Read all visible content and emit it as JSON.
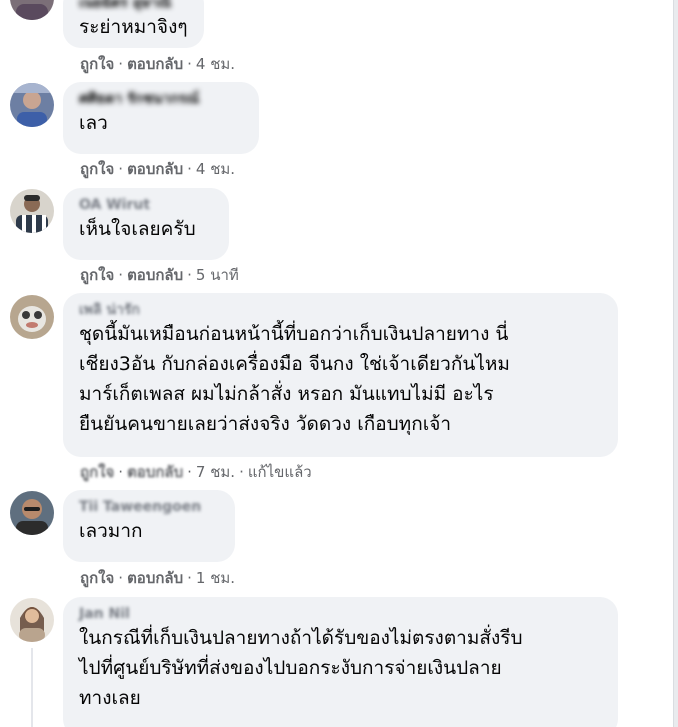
{
  "comments": [
    {
      "author": "เนยฉัตร อุษาณี",
      "text": "ระย่าหมาจิงๆ",
      "like_label": "ถูกใจ",
      "reply_label": "ตอบกลับ",
      "time": "4 ชม."
    },
    {
      "author": "ศศิธดา รักชนากรณ์",
      "text": "เลว",
      "like_label": "ถูกใจ",
      "reply_label": "ตอบกลับ",
      "time": "4 ชม."
    },
    {
      "author": "OA Wirut",
      "text": "เห็นใจเลยครับ",
      "like_label": "ถูกใจ",
      "reply_label": "ตอบกลับ",
      "time": "5 นาที"
    },
    {
      "author": "เพลิ น่ารัก",
      "text": "ชุดนี้มันเหมือนก่อนหน้านี้ที่บอกว่าเก็บเงินปลายทาง นี่\nเชียง3อัน กับกล่องเครื่องมือ จีนกง ใช่เจ้าเดียวกันไหม\nมาร์เก็ตเพลส ผมไม่กล้าสั่ง หรอก มันแทบไม่มี อะไร\nยืนยันคนขายเลยว่าส่งจริง วัดดวง เกือบทุกเจ้า",
      "like_label": "ถูกใจ",
      "reply_label": "ตอบกลับ",
      "time": "7 ชม.",
      "edited_label": "แก้ไขแล้ว"
    },
    {
      "author": "Tii Taweengoen",
      "text": "เลวมาก",
      "like_label": "ถูกใจ",
      "reply_label": "ตอบกลับ",
      "time": "1 ชม."
    },
    {
      "author": "Jan Nil",
      "text": "ในกรณีที่เก็บเงินปลายทางถ้าได้รับของไม่ตรงตามสั่งรีบ\nไปที่ศูนย์บริษัทที่ส่งของไปบอกระงับการจ่ายเงินปลาย\nทางเลย"
    }
  ],
  "separator": "·"
}
